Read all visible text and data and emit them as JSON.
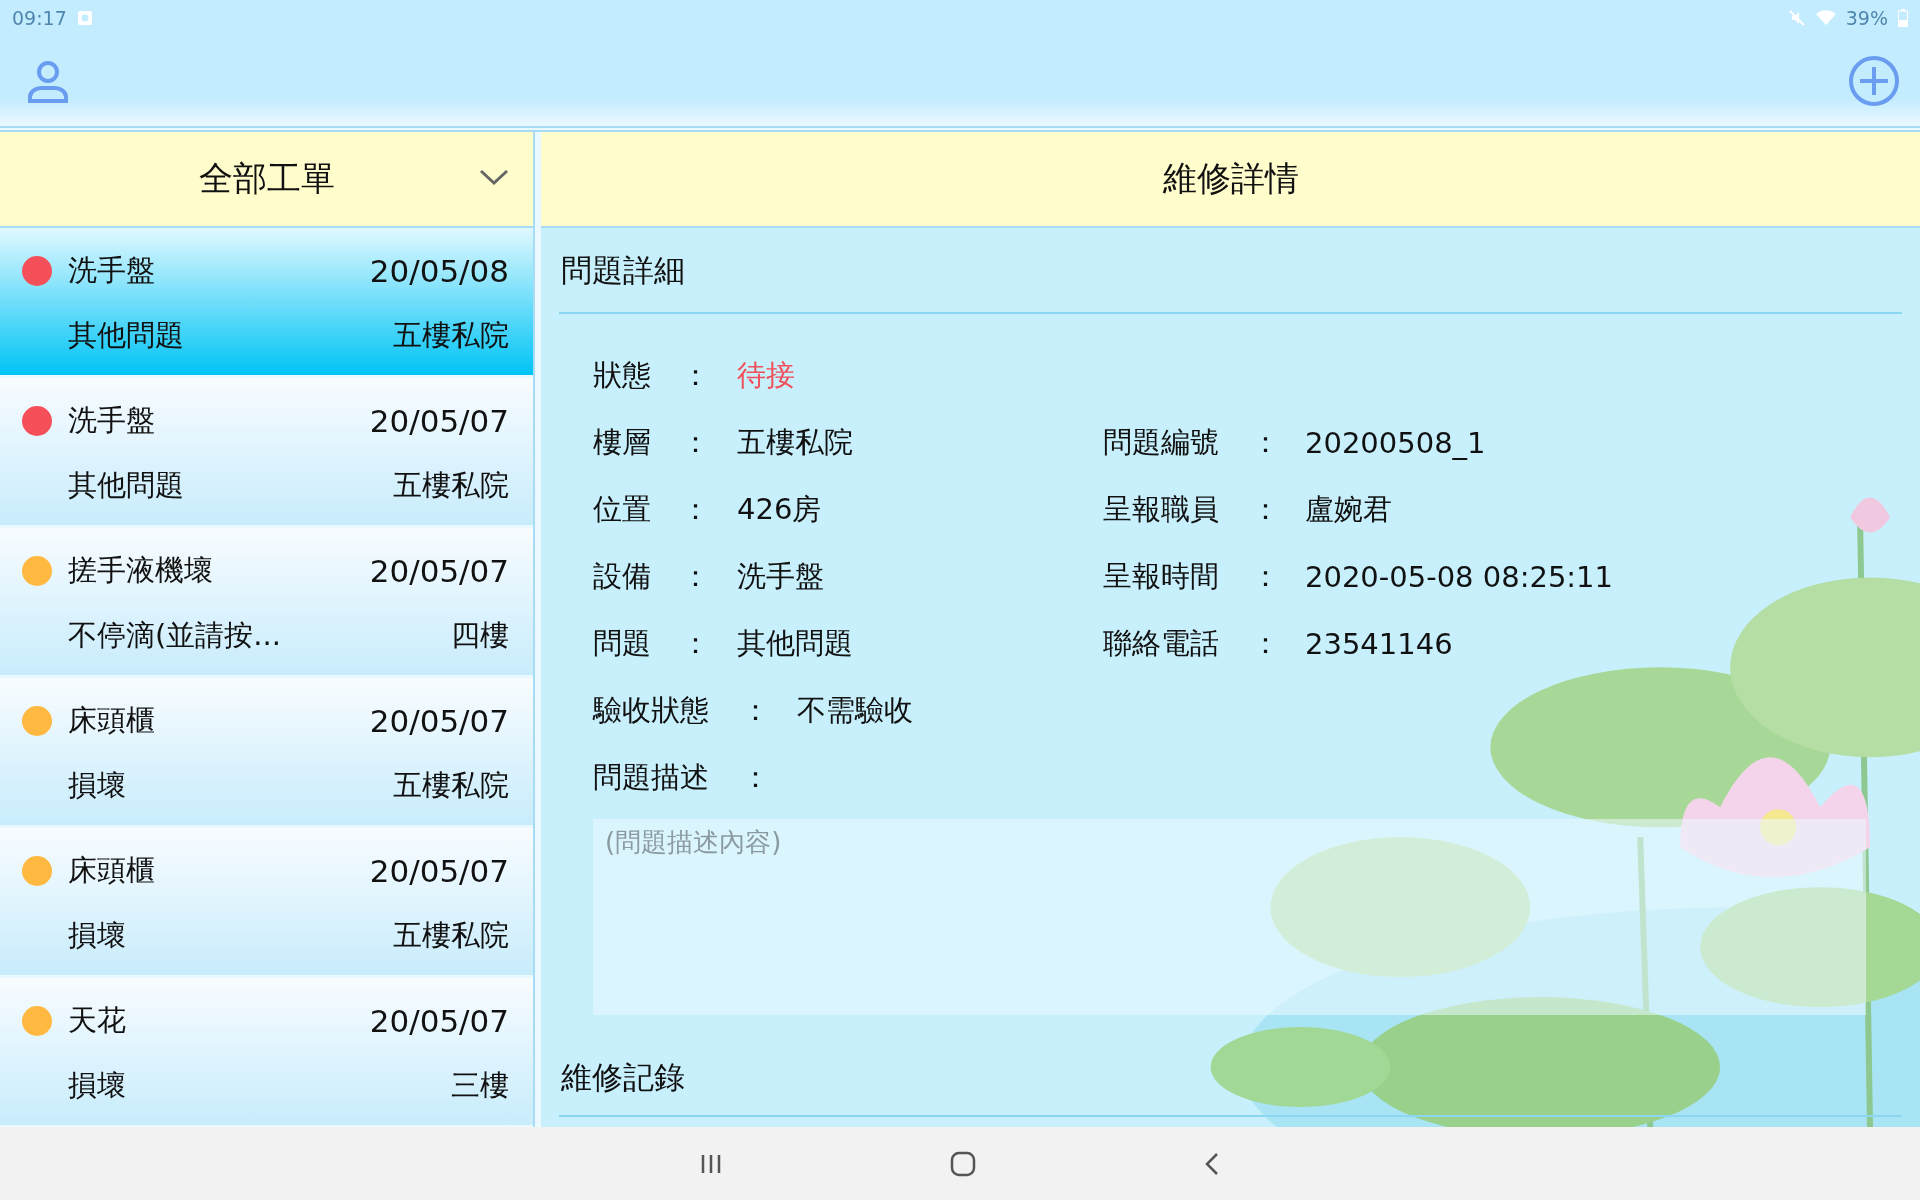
{
  "status_bar": {
    "time": "09:17",
    "battery": "39%"
  },
  "list_header": {
    "title": "全部工單"
  },
  "detail_header": {
    "title": "維修詳情"
  },
  "work_orders": [
    {
      "title": "洗手盤",
      "date": "20/05/08",
      "issue": "其他問題",
      "location": "五樓私院",
      "color": "#f5505a",
      "selected": true
    },
    {
      "title": "洗手盤",
      "date": "20/05/07",
      "issue": "其他問題",
      "location": "五樓私院",
      "color": "#f5505a",
      "selected": false
    },
    {
      "title": "搓手液機壞",
      "date": "20/05/07",
      "issue": "不停滴(並請按...",
      "location": "四樓",
      "color": "#ffb840",
      "selected": false
    },
    {
      "title": "床頭櫃",
      "date": "20/05/07",
      "issue": "損壞",
      "location": "五樓私院",
      "color": "#ffb840",
      "selected": false
    },
    {
      "title": "床頭櫃",
      "date": "20/05/07",
      "issue": "損壞",
      "location": "五樓私院",
      "color": "#ffb840",
      "selected": false
    },
    {
      "title": "天花",
      "date": "20/05/07",
      "issue": "損壞",
      "location": "三樓",
      "color": "#ffb840",
      "selected": false
    }
  ],
  "detail": {
    "section_title": "問題詳細",
    "rows": [
      {
        "left": {
          "label": "狀態",
          "separator": "：",
          "value": "待接",
          "kind": "status"
        }
      },
      {
        "left": {
          "label": "樓層",
          "separator": "：",
          "value": "五樓私院"
        },
        "right": {
          "label": "問題編號",
          "separator": "：",
          "value": "20200508_1"
        }
      },
      {
        "left": {
          "label": "位置",
          "separator": "：",
          "value": "426房"
        },
        "right": {
          "label": "呈報職員",
          "separator": "：",
          "value": "盧婉君"
        }
      },
      {
        "left": {
          "label": "設備",
          "separator": "：",
          "value": "洗手盤"
        },
        "right": {
          "label": "呈報時間",
          "separator": "：",
          "value": "2020-05-08 08:25:11"
        }
      },
      {
        "left": {
          "label": "問題",
          "separator": "：",
          "value": "其他問題"
        },
        "right": {
          "label": "聯絡電話",
          "separator": "：",
          "value": "23541146"
        }
      },
      {
        "left": {
          "label": "驗收狀態",
          "separator": "：",
          "value": "不需驗收",
          "kind": "wide"
        }
      }
    ],
    "description": {
      "label": "問題描述",
      "separator": "：",
      "placeholder": "(問題描述內容)"
    },
    "records_title": "維修記錄"
  }
}
